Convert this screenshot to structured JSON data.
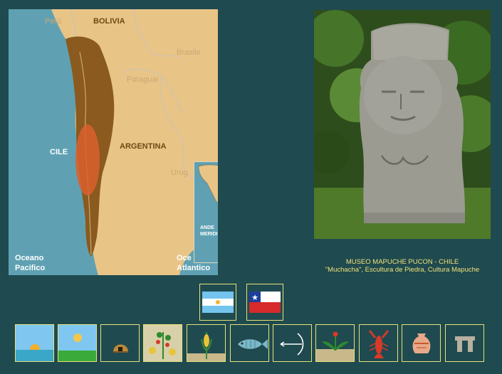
{
  "map": {
    "labels": {
      "peru": "Perù",
      "bolivia": "BOLIVIA",
      "brasile": "Brasile",
      "paraguai": "Paraguai",
      "argentina": "ARGENTINA",
      "cile": "CILE",
      "urug": "Urug",
      "oceano_pacifico_1": "Oceano",
      "oceano_pacifico_2": "Pacifico",
      "oceano_atlantico_1": "Oce",
      "oceano_atlantico_2": "Atlantico"
    },
    "inset_label_1": "ANDE",
    "inset_label_2": "MERIDIONALI",
    "colors": {
      "land": "#e9c487",
      "sea": "#5fa1b3",
      "region": "#8a5a1e",
      "highlight": "#d9602e"
    }
  },
  "photo": {
    "caption_line1": "MUSEO MAPUCHE PUCON - CHILE",
    "caption_line2": "\"Muchacha\", Escultura de Piedra, Cultura Mapuche"
  },
  "flags": [
    {
      "name": "argentina-flag",
      "icon": "flag-argentina"
    },
    {
      "name": "chile-flag",
      "icon": "flag-chile"
    }
  ],
  "icons": [
    {
      "name": "sunset-sea-icon"
    },
    {
      "name": "sun-field-icon"
    },
    {
      "name": "hut-icon"
    },
    {
      "name": "fruit-plant-icon"
    },
    {
      "name": "corn-icon"
    },
    {
      "name": "fish-icon"
    },
    {
      "name": "bow-arrow-icon"
    },
    {
      "name": "flowering-plant-icon"
    },
    {
      "name": "lobster-icon"
    },
    {
      "name": "vase-icon"
    },
    {
      "name": "dolmen-icon"
    }
  ],
  "accent_color": "#e8e27a",
  "background_color": "#1f4a4f"
}
